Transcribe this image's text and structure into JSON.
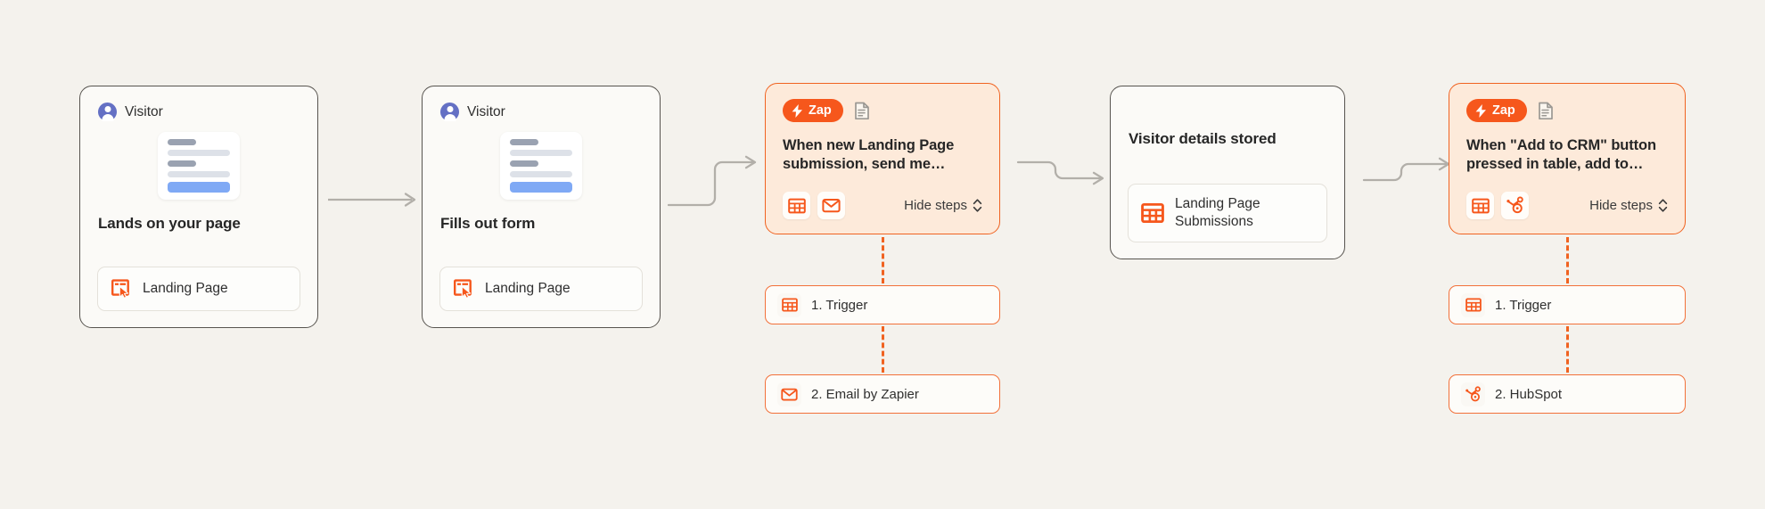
{
  "theme": {
    "background": "#f4f2ed",
    "accent_orange": "#f6571c",
    "card_border": "#5f5c57",
    "zap_card_bg": "#fdeada",
    "avatar_purple": "#6470c4"
  },
  "cards": [
    {
      "id": "lands-on-page",
      "persona": "Visitor",
      "title": "Lands on your page",
      "chip": {
        "label": "Landing Page",
        "icon": "landing-page-icon"
      }
    },
    {
      "id": "fills-out-form",
      "persona": "Visitor",
      "title": "Fills out form",
      "chip": {
        "label": "Landing Page",
        "icon": "landing-page-icon"
      }
    },
    {
      "id": "zap-email",
      "badge": "Zap",
      "badge_icon": "zap-bolt-icon",
      "doc_icon": "document-icon",
      "title": "When new Landing Page submission, send me…",
      "app_icons": [
        "tables-icon",
        "email-icon"
      ],
      "toggle_label": "Hide steps",
      "toggle_icon": "chevron-updown-icon",
      "steps": [
        {
          "label": "1. Trigger",
          "icon": "tables-icon"
        },
        {
          "label": "2. Email by Zapier",
          "icon": "email-icon"
        }
      ]
    },
    {
      "id": "visitor-details-stored",
      "title": "Visitor details stored",
      "chip": {
        "label": "Landing Page Submissions",
        "icon": "tables-icon"
      }
    },
    {
      "id": "zap-hubspot",
      "badge": "Zap",
      "badge_icon": "zap-bolt-icon",
      "doc_icon": "document-icon",
      "title": "When \"Add to CRM\" button pressed in table, add to…",
      "app_icons": [
        "tables-icon",
        "hubspot-icon"
      ],
      "toggle_label": "Hide steps",
      "toggle_icon": "chevron-updown-icon",
      "steps": [
        {
          "label": "1. Trigger",
          "icon": "tables-icon"
        },
        {
          "label": "2. HubSpot",
          "icon": "hubspot-icon"
        }
      ]
    }
  ],
  "connectors": [
    {
      "id": "conn-1",
      "from": "lands-on-page",
      "to": "fills-out-form",
      "shape": "straight"
    },
    {
      "id": "conn-2",
      "from": "fills-out-form",
      "to": "zap-email",
      "shape": "step-up"
    },
    {
      "id": "conn-3",
      "from": "zap-email",
      "to": "visitor-details-stored",
      "shape": "step-down"
    },
    {
      "id": "conn-4",
      "from": "visitor-details-stored",
      "to": "zap-hubspot",
      "shape": "step-up"
    }
  ]
}
